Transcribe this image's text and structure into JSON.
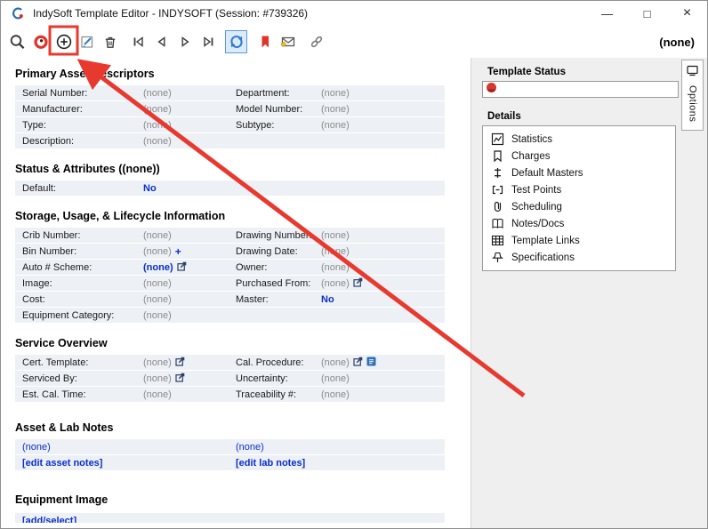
{
  "window": {
    "title": "IndySoft Template Editor - INDYSOFT (Session: #739326)",
    "controls": {
      "minimize": "—",
      "maximize": "□",
      "close": "×"
    }
  },
  "toolbar": {
    "record_label": "(none)",
    "buttons": [
      "search",
      "view",
      "add",
      "edit",
      "delete",
      "first-record",
      "previous-record",
      "next-record",
      "last-record",
      "refresh",
      "bookmark",
      "email",
      "link"
    ],
    "selected_button": "refresh",
    "highlighted_button": "add"
  },
  "annotation": {
    "color": "#e8392f",
    "highlight_target": "add-button"
  },
  "colors": {
    "link_blue": "#0a2ecc",
    "row_bg": "#edf1f6",
    "annotation_red": "#e8392f",
    "selected_border": "#5b9bd5"
  },
  "sections": {
    "primary": {
      "title": "Primary Asset Descriptors"
    },
    "status": {
      "title": "Status & Attributes ((none))"
    },
    "storage": {
      "title": "Storage, Usage, & Lifecycle Information"
    },
    "service": {
      "title": "Service Overview"
    },
    "notes": {
      "title": "Asset & Lab Notes"
    },
    "image": {
      "title": "Equipment Image"
    }
  },
  "fields": {
    "serial_number": {
      "label": "Serial Number:",
      "value": "(none)"
    },
    "department": {
      "label": "Department:",
      "value": "(none)"
    },
    "manufacturer": {
      "label": "Manufacturer:",
      "value": "(none)"
    },
    "model_number": {
      "label": "Model Number:",
      "value": "(none)"
    },
    "type": {
      "label": "Type:",
      "value": "(none)"
    },
    "subtype": {
      "label": "Subtype:",
      "value": "(none)"
    },
    "description": {
      "label": "Description:",
      "value": "(none)"
    },
    "default": {
      "label": "Default:",
      "value": "No"
    },
    "crib_number": {
      "label": "Crib Number:",
      "value": "(none)"
    },
    "drawing_number": {
      "label": "Drawing Number:",
      "value": "(none)"
    },
    "bin_number": {
      "label": "Bin Number:",
      "value": "(none)",
      "action": "+"
    },
    "drawing_date": {
      "label": "Drawing Date:",
      "value": "(none)"
    },
    "auto_scheme": {
      "label": "Auto # Scheme:",
      "value": "(none)"
    },
    "owner": {
      "label": "Owner:",
      "value": "(none)"
    },
    "image": {
      "label": "Image:",
      "value": "(none)"
    },
    "purchased_from": {
      "label": "Purchased From:",
      "value": "(none)"
    },
    "cost": {
      "label": "Cost:",
      "value": "(none)"
    },
    "master": {
      "label": "Master:",
      "value": "No"
    },
    "equipment_category": {
      "label": "Equipment Category:",
      "value": "(none)"
    },
    "cert_template": {
      "label": "Cert. Template:",
      "value": "(none)"
    },
    "cal_procedure": {
      "label": "Cal. Procedure:",
      "value": "(none)"
    },
    "serviced_by": {
      "label": "Serviced By:",
      "value": "(none)"
    },
    "uncertainty": {
      "label": "Uncertainty:",
      "value": "(none)"
    },
    "est_cal_time": {
      "label": "Est. Cal. Time:",
      "value": "(none)"
    },
    "traceability": {
      "label": "Traceability #:",
      "value": "(none)"
    },
    "asset_note": {
      "value": "(none)"
    },
    "lab_note": {
      "value": "(none)"
    },
    "edit_asset_notes": {
      "label": "[edit asset notes]"
    },
    "edit_lab_notes": {
      "label": "[edit lab notes]"
    },
    "add_select_image": {
      "label": "[add/select]"
    }
  },
  "sidebar": {
    "template_status_label": "Template Status",
    "details_label": "Details",
    "details": [
      {
        "label": "Statistics",
        "icon": "statistics-icon"
      },
      {
        "label": "Charges",
        "icon": "charges-icon"
      },
      {
        "label": "Default Masters",
        "icon": "default-masters-icon"
      },
      {
        "label": "Test Points",
        "icon": "test-points-icon"
      },
      {
        "label": "Scheduling",
        "icon": "scheduling-icon"
      },
      {
        "label": "Notes/Docs",
        "icon": "notes-docs-icon"
      },
      {
        "label": "Template Links",
        "icon": "template-links-icon"
      },
      {
        "label": "Specifications",
        "icon": "specifications-icon"
      }
    ],
    "options_tab": "Options"
  }
}
